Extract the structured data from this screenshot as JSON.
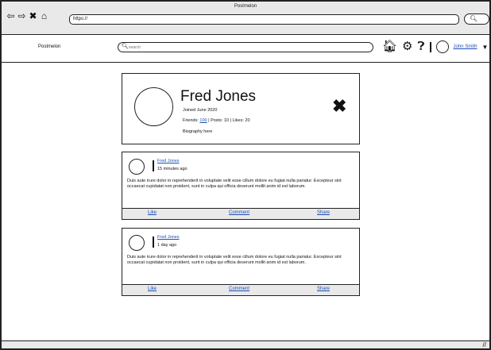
{
  "window": {
    "title": "Postmelon"
  },
  "browser": {
    "url": "https://"
  },
  "header": {
    "brand": "Postmelon",
    "search_placeholder": "search",
    "user_name": "John Smith"
  },
  "profile": {
    "name": "Fred Jones",
    "joined": "Joined June 2020",
    "friends_label": "Friends:",
    "friends_count": "100",
    "stats_rest": "| Posts: 10 | Likes: 20",
    "bio": "Biography here"
  },
  "posts": [
    {
      "author": "Fred Jones",
      "time": "15 minutes ago",
      "body": "Duis aute irure dolor in reprehenderit in voluptate velit esse cillum dolore eu fugiat nulla pariatur. Excepteur sint occaecat cupidatat non proident, sunt in culpa qui officia deserunt mollit anim id est laborum.",
      "like": "Like",
      "comment": "Comment",
      "share": "Share"
    },
    {
      "author": "Fred Jones",
      "time": "1 day ago",
      "body": "Duis aute irure dolor in reprehenderit in voluptate velit esse cillum dolore eu fugiat nulla pariatur. Excepteur sint occaecat cupidatat non proident, sunt in culpa qui officia deserunt mollit anim id est laborum.",
      "like": "Like",
      "comment": "Comment",
      "share": "Share"
    }
  ],
  "icons": {
    "back": "back-arrow-icon",
    "forward": "forward-arrow-icon",
    "stop": "close-icon",
    "home": "home-icon",
    "search": "search-icon",
    "settings": "gear-icon",
    "help": "help-icon",
    "dropdown": "caret-down-icon"
  },
  "colors": {
    "link": "#1a4fb5",
    "chrome": "#e9e9e9"
  }
}
